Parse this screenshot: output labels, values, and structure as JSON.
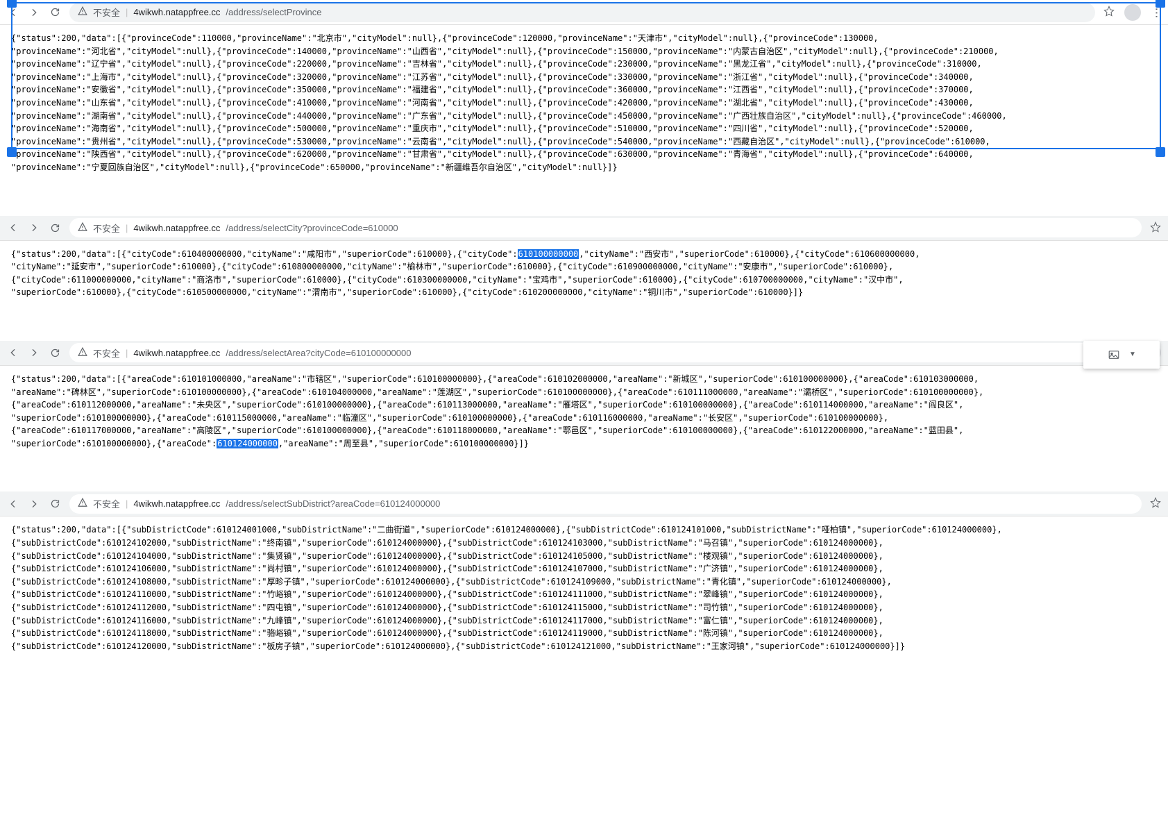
{
  "insecure_label": "不安全",
  "panes": [
    {
      "host": "4wikwh.natappfree.cc",
      "path": "/address/selectProvince",
      "json": {
        "status": 200,
        "data": [
          {
            "provinceCode": 110000,
            "provinceName": "北京市",
            "cityModel": null
          },
          {
            "provinceCode": 120000,
            "provinceName": "天津市",
            "cityModel": null
          },
          {
            "provinceCode": 130000,
            "provinceName": "河北省",
            "cityModel": null
          },
          {
            "provinceCode": 140000,
            "provinceName": "山西省",
            "cityModel": null
          },
          {
            "provinceCode": 150000,
            "provinceName": "内蒙古自治区",
            "cityModel": null
          },
          {
            "provinceCode": 210000,
            "provinceName": "辽宁省",
            "cityModel": null
          },
          {
            "provinceCode": 220000,
            "provinceName": "吉林省",
            "cityModel": null
          },
          {
            "provinceCode": 230000,
            "provinceName": "黑龙江省",
            "cityModel": null
          },
          {
            "provinceCode": 310000,
            "provinceName": "上海市",
            "cityModel": null
          },
          {
            "provinceCode": 320000,
            "provinceName": "江苏省",
            "cityModel": null
          },
          {
            "provinceCode": 330000,
            "provinceName": "浙江省",
            "cityModel": null
          },
          {
            "provinceCode": 340000,
            "provinceName": "安徽省",
            "cityModel": null
          },
          {
            "provinceCode": 350000,
            "provinceName": "福建省",
            "cityModel": null
          },
          {
            "provinceCode": 360000,
            "provinceName": "江西省",
            "cityModel": null
          },
          {
            "provinceCode": 370000,
            "provinceName": "山东省",
            "cityModel": null
          },
          {
            "provinceCode": 410000,
            "provinceName": "河南省",
            "cityModel": null
          },
          {
            "provinceCode": 420000,
            "provinceName": "湖北省",
            "cityModel": null
          },
          {
            "provinceCode": 430000,
            "provinceName": "湖南省",
            "cityModel": null
          },
          {
            "provinceCode": 440000,
            "provinceName": "广东省",
            "cityModel": null
          },
          {
            "provinceCode": 450000,
            "provinceName": "广西壮族自治区",
            "cityModel": null
          },
          {
            "provinceCode": 460000,
            "provinceName": "海南省",
            "cityModel": null
          },
          {
            "provinceCode": 500000,
            "provinceName": "重庆市",
            "cityModel": null
          },
          {
            "provinceCode": 510000,
            "provinceName": "四川省",
            "cityModel": null
          },
          {
            "provinceCode": 520000,
            "provinceName": "贵州省",
            "cityModel": null
          },
          {
            "provinceCode": 530000,
            "provinceName": "云南省",
            "cityModel": null
          },
          {
            "provinceCode": 540000,
            "provinceName": "西藏自治区",
            "cityModel": null
          },
          {
            "provinceCode": 610000,
            "provinceName": "陕西省",
            "cityModel": null
          },
          {
            "provinceCode": 620000,
            "provinceName": "甘肃省",
            "cityModel": null
          },
          {
            "provinceCode": 630000,
            "provinceName": "青海省",
            "cityModel": null
          },
          {
            "provinceCode": 640000,
            "provinceName": "宁夏回族自治区",
            "cityModel": null
          },
          {
            "provinceCode": 650000,
            "provinceName": "新疆维吾尔自治区",
            "cityModel": null
          }
        ]
      }
    },
    {
      "host": "4wikwh.natappfree.cc",
      "path": "/address/selectCity?provinceCode=610000",
      "highlight": "610100000000",
      "json": {
        "status": 200,
        "data": [
          {
            "cityCode": 610400000000,
            "cityName": "咸阳市",
            "superiorCode": 610000
          },
          {
            "cityCode": 610100000000,
            "cityName": "西安市",
            "superiorCode": 610000
          },
          {
            "cityCode": 610600000000,
            "cityName": "延安市",
            "superiorCode": 610000
          },
          {
            "cityCode": 610800000000,
            "cityName": "榆林市",
            "superiorCode": 610000
          },
          {
            "cityCode": 610900000000,
            "cityName": "安康市",
            "superiorCode": 610000
          },
          {
            "cityCode": 611000000000,
            "cityName": "商洛市",
            "superiorCode": 610000
          },
          {
            "cityCode": 610300000000,
            "cityName": "宝鸡市",
            "superiorCode": 610000
          },
          {
            "cityCode": 610700000000,
            "cityName": "汉中市",
            "superiorCode": 610000
          },
          {
            "cityCode": 610500000000,
            "cityName": "渭南市",
            "superiorCode": 610000
          },
          {
            "cityCode": 610200000000,
            "cityName": "铜川市",
            "superiorCode": 610000
          }
        ]
      }
    },
    {
      "host": "4wikwh.natappfree.cc",
      "path": "/address/selectArea?cityCode=610100000000",
      "highlight": "610124000000",
      "json": {
        "status": 200,
        "data": [
          {
            "areaCode": 610101000000,
            "areaName": "市辖区",
            "superiorCode": 610100000000
          },
          {
            "areaCode": 610102000000,
            "areaName": "新城区",
            "superiorCode": 610100000000
          },
          {
            "areaCode": 610103000000,
            "areaName": "碑林区",
            "superiorCode": 610100000000
          },
          {
            "areaCode": 610104000000,
            "areaName": "莲湖区",
            "superiorCode": 610100000000
          },
          {
            "areaCode": 610111000000,
            "areaName": "灞桥区",
            "superiorCode": 610100000000
          },
          {
            "areaCode": 610112000000,
            "areaName": "未央区",
            "superiorCode": 610100000000
          },
          {
            "areaCode": 610113000000,
            "areaName": "雁塔区",
            "superiorCode": 610100000000
          },
          {
            "areaCode": 610114000000,
            "areaName": "阎良区",
            "superiorCode": 610100000000
          },
          {
            "areaCode": 610115000000,
            "areaName": "临潼区",
            "superiorCode": 610100000000
          },
          {
            "areaCode": 610116000000,
            "areaName": "长安区",
            "superiorCode": 610100000000
          },
          {
            "areaCode": 610117000000,
            "areaName": "高陵区",
            "superiorCode": 610100000000
          },
          {
            "areaCode": 610118000000,
            "areaName": "鄠邑区",
            "superiorCode": 610100000000
          },
          {
            "areaCode": 610122000000,
            "areaName": "蓝田县",
            "superiorCode": 610100000000
          },
          {
            "areaCode": 610124000000,
            "areaName": "周至县",
            "superiorCode": 610100000000
          }
        ]
      }
    },
    {
      "host": "4wikwh.natappfree.cc",
      "path": "/address/selectSubDistrict?areaCode=610124000000",
      "json": {
        "status": 200,
        "data": [
          {
            "subDistrictCode": 610124001000,
            "subDistrictName": "二曲街道",
            "superiorCode": 610124000000
          },
          {
            "subDistrictCode": 610124101000,
            "subDistrictName": "哑柏镇",
            "superiorCode": 610124000000
          },
          {
            "subDistrictCode": 610124102000,
            "subDistrictName": "终南镇",
            "superiorCode": 610124000000
          },
          {
            "subDistrictCode": 610124103000,
            "subDistrictName": "马召镇",
            "superiorCode": 610124000000
          },
          {
            "subDistrictCode": 610124104000,
            "subDistrictName": "集贤镇",
            "superiorCode": 610124000000
          },
          {
            "subDistrictCode": 610124105000,
            "subDistrictName": "楼观镇",
            "superiorCode": 610124000000
          },
          {
            "subDistrictCode": 610124106000,
            "subDistrictName": "尚村镇",
            "superiorCode": 610124000000
          },
          {
            "subDistrictCode": 610124107000,
            "subDistrictName": "广济镇",
            "superiorCode": 610124000000
          },
          {
            "subDistrictCode": 610124108000,
            "subDistrictName": "厚畛子镇",
            "superiorCode": 610124000000
          },
          {
            "subDistrictCode": 610124109000,
            "subDistrictName": "青化镇",
            "superiorCode": 610124000000
          },
          {
            "subDistrictCode": 610124110000,
            "subDistrictName": "竹峪镇",
            "superiorCode": 610124000000
          },
          {
            "subDistrictCode": 610124111000,
            "subDistrictName": "翠峰镇",
            "superiorCode": 610124000000
          },
          {
            "subDistrictCode": 610124112000,
            "subDistrictName": "四屯镇",
            "superiorCode": 610124000000
          },
          {
            "subDistrictCode": 610124115000,
            "subDistrictName": "司竹镇",
            "superiorCode": 610124000000
          },
          {
            "subDistrictCode": 610124116000,
            "subDistrictName": "九峰镇",
            "superiorCode": 610124000000
          },
          {
            "subDistrictCode": 610124117000,
            "subDistrictName": "富仁镇",
            "superiorCode": 610124000000
          },
          {
            "subDistrictCode": 610124118000,
            "subDistrictName": "骆峪镇",
            "superiorCode": 610124000000
          },
          {
            "subDistrictCode": 610124119000,
            "subDistrictName": "陈河镇",
            "superiorCode": 610124000000
          },
          {
            "subDistrictCode": 610124120000,
            "subDistrictName": "板房子镇",
            "superiorCode": 610124000000
          },
          {
            "subDistrictCode": 610124121000,
            "subDistrictName": "王家河镇",
            "superiorCode": 610124000000
          }
        ]
      }
    }
  ]
}
